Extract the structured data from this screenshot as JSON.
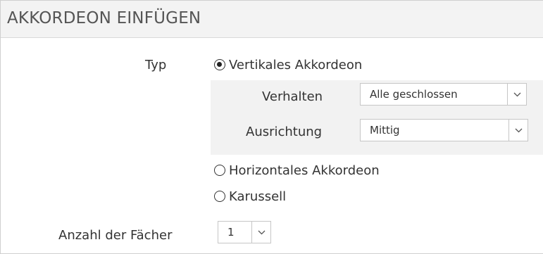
{
  "dialog": {
    "title": "AKKORDEON EINFÜGEN"
  },
  "typ": {
    "label": "Typ",
    "options": [
      {
        "label": "Vertikales Akkordeon",
        "checked": true
      },
      {
        "label": "Horizontales Akkordeon",
        "checked": false
      },
      {
        "label": "Karussell",
        "checked": false
      }
    ]
  },
  "verhalten": {
    "label": "Verhalten",
    "value": "Alle geschlossen",
    "icon": "chevron-down-icon"
  },
  "ausrichtung": {
    "label": "Ausrichtung",
    "value": "Mittig",
    "icon": "chevron-down-icon"
  },
  "anzahl": {
    "label": "Anzahl der Fächer",
    "value": "1",
    "icon": "chevron-down-icon"
  }
}
